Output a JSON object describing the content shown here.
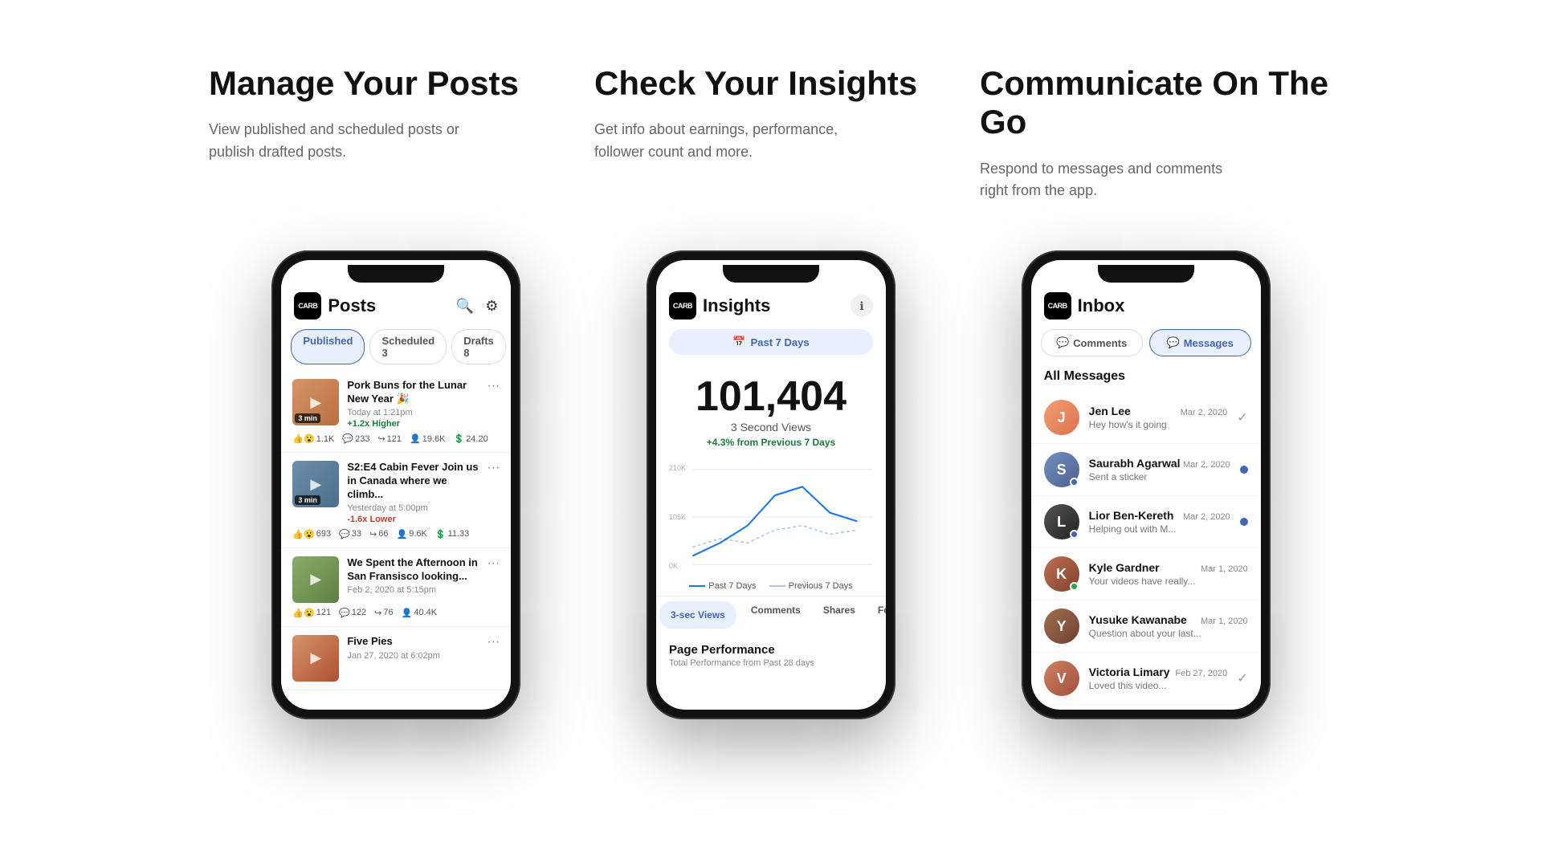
{
  "features": [
    {
      "id": "posts",
      "title": "Manage Your Posts",
      "desc": "View published and scheduled posts or publish drafted posts."
    },
    {
      "id": "insights",
      "title": "Check Your Insights",
      "desc": "Get info about earnings, performance, follower count and more."
    },
    {
      "id": "communicate",
      "title": "Communicate On The Go",
      "desc": "Respond to messages and comments right from the app."
    }
  ],
  "posts_phone": {
    "app_name": "CARB",
    "screen_title": "Posts",
    "tabs": [
      {
        "label": "Published",
        "active": true
      },
      {
        "label": "Scheduled 3",
        "active": false
      },
      {
        "label": "Drafts 8",
        "active": false
      }
    ],
    "posts": [
      {
        "title": "Pork Buns for the Lunar New Year 🎉",
        "date": "Today at 1:21pm",
        "perf": "+1.2x Higher",
        "perf_type": "higher",
        "duration": "3 min",
        "thumb_type": "food",
        "stats": {
          "reactions": "1.1K",
          "comments": "233",
          "shares": "121",
          "views": "19.6K",
          "earnings": "24.20"
        }
      },
      {
        "title": "S2:E4 Cabin Fever Join us in Canada where we climb...",
        "date": "Yesterday at 5:00pm",
        "perf": "-1.6x Lower",
        "perf_type": "lower",
        "duration": "3 min",
        "thumb_type": "cabin",
        "stats": {
          "reactions": "693",
          "comments": "33",
          "shares": "66",
          "views": "9.6K",
          "earnings": "11.33"
        }
      },
      {
        "title": "We Spent the Afternoon in San Fransisco looking...",
        "date": "Feb 2, 2020 at 5:15pm",
        "perf": "",
        "perf_type": "neutral",
        "duration": "",
        "thumb_type": "afternoon",
        "stats": {
          "reactions": "121",
          "comments": "122",
          "shares": "76",
          "views": "40.4K",
          "earnings": ""
        }
      },
      {
        "title": "Five Pies",
        "date": "Jan 27, 2020 at 6:02pm",
        "perf": "",
        "perf_type": "neutral",
        "duration": "",
        "thumb_type": "pies",
        "stats": {
          "reactions": "",
          "comments": "",
          "shares": "",
          "views": "",
          "earnings": ""
        }
      }
    ]
  },
  "insights_phone": {
    "app_name": "CARB",
    "screen_title": "Insights",
    "date_range": "Past 7 Days",
    "metric_number": "101,404",
    "metric_label": "3 Second Views",
    "metric_change": "+4.3% from Previous 7 Days",
    "chart": {
      "y_labels": [
        "210K",
        "105K",
        "0K"
      ],
      "legend": [
        "Past 7 Days",
        "Previous 7 Days"
      ]
    },
    "tabs": [
      "3-sec Views",
      "Comments",
      "Shares",
      "Follo..."
    ],
    "page_perf_title": "Page Performance",
    "page_perf_sub": "Total Performance from Past 28 days"
  },
  "inbox_phone": {
    "app_name": "CARB",
    "screen_title": "Inbox",
    "tabs": [
      {
        "label": "Comments",
        "active": false,
        "icon": "💬"
      },
      {
        "label": "Messages",
        "active": true,
        "icon": "💬"
      }
    ],
    "section_label": "All Messages",
    "messages": [
      {
        "name": "Jen Lee",
        "preview": "Hey how's it going",
        "date": "Mar 2, 2020",
        "avatar_class": "av-jen",
        "unread": false,
        "check": true,
        "dot_color": ""
      },
      {
        "name": "Saurabh Agarwal",
        "preview": "Sent a sticker",
        "date": "Mar 2, 2020",
        "avatar_class": "av-saurabh",
        "unread": true,
        "check": false,
        "dot_color": "dot-blue"
      },
      {
        "name": "Lior Ben-Kereth",
        "preview": "Helping out with M...",
        "date": "Mar 2, 2020",
        "avatar_class": "av-lior",
        "unread": true,
        "check": false,
        "dot_color": "dot-blue"
      },
      {
        "name": "Kyle Gardner",
        "preview": "Your videos have really...",
        "date": "Mar 1, 2020",
        "avatar_class": "av-kyle",
        "unread": false,
        "check": false,
        "dot_color": "dot-green"
      },
      {
        "name": "Yusuke Kawanabe",
        "preview": "Question about your last...",
        "date": "Mar 1, 2020",
        "avatar_class": "av-yusuke",
        "unread": false,
        "check": false,
        "dot_color": ""
      },
      {
        "name": "Victoria Limary",
        "preview": "Loved this video...",
        "date": "Feb 27, 2020",
        "avatar_class": "av-victoria",
        "unread": false,
        "check": true,
        "dot_color": ""
      }
    ]
  }
}
